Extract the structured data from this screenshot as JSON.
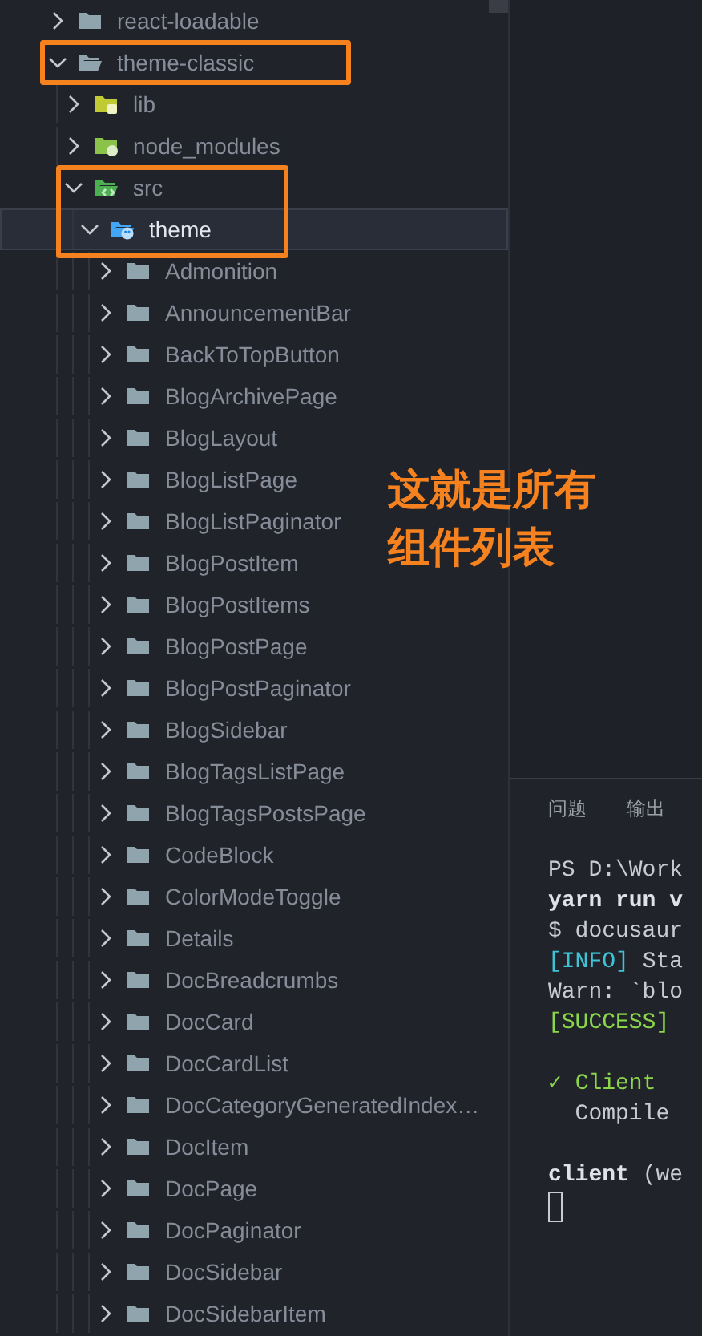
{
  "explorer": {
    "tree": [
      {
        "label": "react-loadable",
        "kind": "folder",
        "expanded": false,
        "selected": false,
        "outlined": false
      },
      {
        "label": "theme-classic",
        "kind": "folder",
        "expanded": true,
        "selected": false,
        "outlined": true,
        "children": [
          {
            "label": "lib",
            "kind": "lib",
            "expanded": false,
            "selected": false,
            "outlined": false
          },
          {
            "label": "node_modules",
            "kind": "node",
            "expanded": false,
            "selected": false,
            "outlined": false
          },
          {
            "label": "src",
            "kind": "src",
            "expanded": true,
            "selected": false,
            "outlined": true,
            "children": [
              {
                "label": "theme",
                "kind": "theme",
                "expanded": true,
                "selected": true,
                "outlined": true,
                "children": [
                  {
                    "label": "Admonition",
                    "kind": "folder",
                    "expanded": false,
                    "selected": false,
                    "outlined": false
                  },
                  {
                    "label": "AnnouncementBar",
                    "kind": "folder",
                    "expanded": false,
                    "selected": false,
                    "outlined": false
                  },
                  {
                    "label": "BackToTopButton",
                    "kind": "folder",
                    "expanded": false,
                    "selected": false,
                    "outlined": false
                  },
                  {
                    "label": "BlogArchivePage",
                    "kind": "folder",
                    "expanded": false,
                    "selected": false,
                    "outlined": false
                  },
                  {
                    "label": "BlogLayout",
                    "kind": "folder",
                    "expanded": false,
                    "selected": false,
                    "outlined": false
                  },
                  {
                    "label": "BlogListPage",
                    "kind": "folder",
                    "expanded": false,
                    "selected": false,
                    "outlined": false
                  },
                  {
                    "label": "BlogListPaginator",
                    "kind": "folder",
                    "expanded": false,
                    "selected": false,
                    "outlined": false
                  },
                  {
                    "label": "BlogPostItem",
                    "kind": "folder",
                    "expanded": false,
                    "selected": false,
                    "outlined": false
                  },
                  {
                    "label": "BlogPostItems",
                    "kind": "folder",
                    "expanded": false,
                    "selected": false,
                    "outlined": false
                  },
                  {
                    "label": "BlogPostPage",
                    "kind": "folder",
                    "expanded": false,
                    "selected": false,
                    "outlined": false
                  },
                  {
                    "label": "BlogPostPaginator",
                    "kind": "folder",
                    "expanded": false,
                    "selected": false,
                    "outlined": false
                  },
                  {
                    "label": "BlogSidebar",
                    "kind": "folder",
                    "expanded": false,
                    "selected": false,
                    "outlined": false
                  },
                  {
                    "label": "BlogTagsListPage",
                    "kind": "folder",
                    "expanded": false,
                    "selected": false,
                    "outlined": false
                  },
                  {
                    "label": "BlogTagsPostsPage",
                    "kind": "folder",
                    "expanded": false,
                    "selected": false,
                    "outlined": false
                  },
                  {
                    "label": "CodeBlock",
                    "kind": "folder",
                    "expanded": false,
                    "selected": false,
                    "outlined": false
                  },
                  {
                    "label": "ColorModeToggle",
                    "kind": "folder",
                    "expanded": false,
                    "selected": false,
                    "outlined": false
                  },
                  {
                    "label": "Details",
                    "kind": "folder",
                    "expanded": false,
                    "selected": false,
                    "outlined": false
                  },
                  {
                    "label": "DocBreadcrumbs",
                    "kind": "folder",
                    "expanded": false,
                    "selected": false,
                    "outlined": false
                  },
                  {
                    "label": "DocCard",
                    "kind": "folder",
                    "expanded": false,
                    "selected": false,
                    "outlined": false
                  },
                  {
                    "label": "DocCardList",
                    "kind": "folder",
                    "expanded": false,
                    "selected": false,
                    "outlined": false
                  },
                  {
                    "label": "DocCategoryGeneratedIndex…",
                    "kind": "folder",
                    "expanded": false,
                    "selected": false,
                    "outlined": false
                  },
                  {
                    "label": "DocItem",
                    "kind": "folder",
                    "expanded": false,
                    "selected": false,
                    "outlined": false
                  },
                  {
                    "label": "DocPage",
                    "kind": "folder",
                    "expanded": false,
                    "selected": false,
                    "outlined": false
                  },
                  {
                    "label": "DocPaginator",
                    "kind": "folder",
                    "expanded": false,
                    "selected": false,
                    "outlined": false
                  },
                  {
                    "label": "DocSidebar",
                    "kind": "folder",
                    "expanded": false,
                    "selected": false,
                    "outlined": false
                  },
                  {
                    "label": "DocSidebarItem",
                    "kind": "folder",
                    "expanded": false,
                    "selected": false,
                    "outlined": false
                  }
                ]
              }
            ]
          }
        ]
      }
    ]
  },
  "annotation": {
    "lines": [
      "这就是所有",
      "组件列表"
    ]
  },
  "panel": {
    "tabs": [
      {
        "label": "问题",
        "selected": false
      },
      {
        "label": "输出",
        "selected": false
      }
    ],
    "terminal": {
      "blocks": [
        {
          "lines": [
            {
              "segments": [
                {
                  "text": "PS D:\\Work",
                  "kind": "plain"
                }
              ]
            },
            {
              "segments": [
                {
                  "text": "yarn run v",
                  "kind": "bold"
                }
              ]
            },
            {
              "segments": [
                {
                  "text": "$ docusaur",
                  "kind": "plain"
                }
              ]
            },
            {
              "segments": [
                {
                  "text": "[INFO]",
                  "kind": "info"
                },
                {
                  "text": " Sta",
                  "kind": "plain"
                }
              ]
            },
            {
              "segments": [
                {
                  "text": "Warn: `blo",
                  "kind": "plain"
                }
              ]
            },
            {
              "segments": [
                {
                  "text": "[SUCCESS]",
                  "kind": "success"
                }
              ]
            }
          ]
        },
        {
          "lines": [
            {
              "segments": [
                {
                  "text": "✓ Client",
                  "kind": "success"
                }
              ]
            },
            {
              "segments": [
                {
                  "text": "  Compile",
                  "kind": "plain"
                }
              ]
            }
          ]
        },
        {
          "lines": [
            {
              "segments": [
                {
                  "text": "client",
                  "kind": "bold"
                },
                {
                  "text": " (we",
                  "kind": "plain"
                }
              ]
            }
          ]
        }
      ],
      "cursor_visible": true
    }
  }
}
